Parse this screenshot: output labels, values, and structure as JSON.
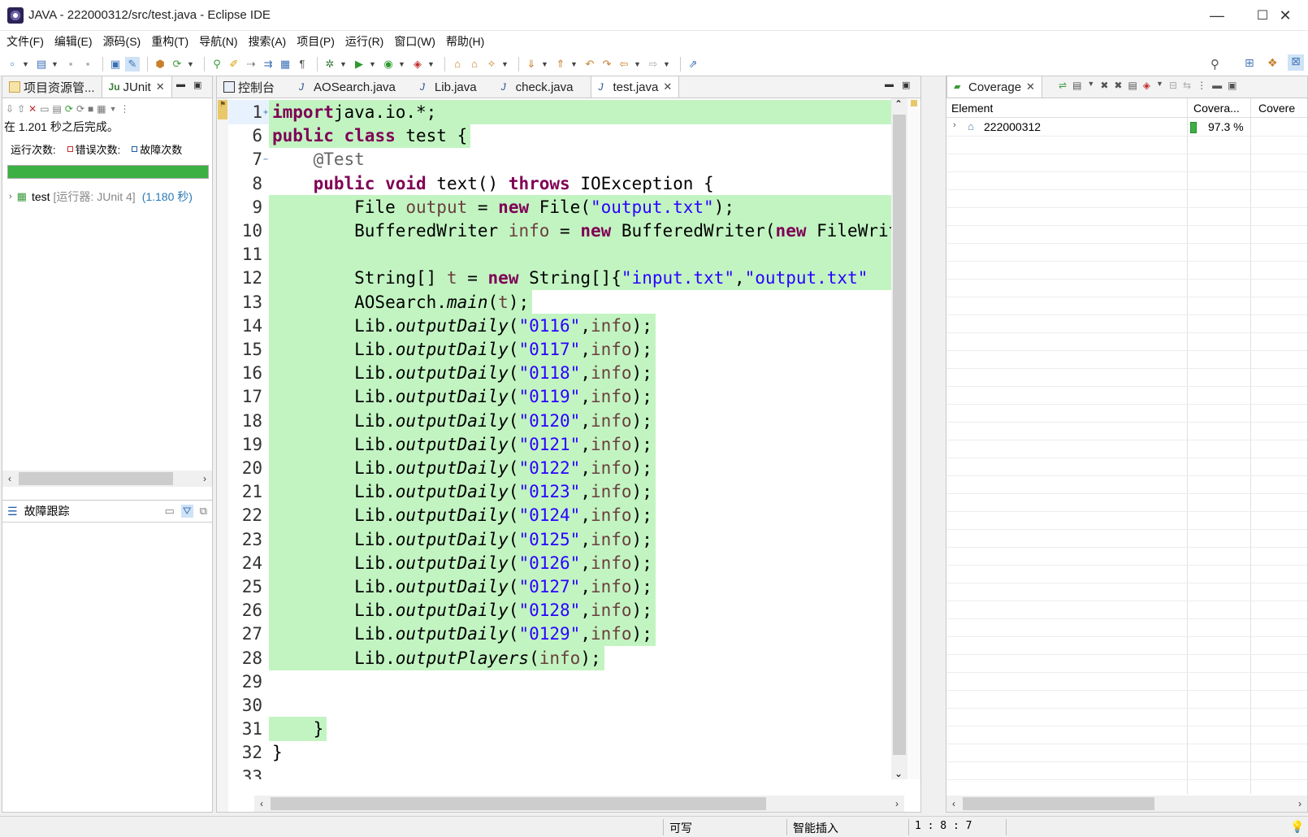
{
  "window": {
    "title": "JAVA - 222000312/src/test.java - Eclipse IDE",
    "minimize": "—",
    "maximize": "☐",
    "close": "✕"
  },
  "menu": [
    "文件(F)",
    "编辑(E)",
    "源码(S)",
    "重构(T)",
    "导航(N)",
    "搜索(A)",
    "项目(P)",
    "运行(R)",
    "窗口(W)",
    "帮助(H)"
  ],
  "left_panel": {
    "tabs": [
      {
        "label": "项目资源管...",
        "icon": "package-explorer-icon"
      },
      {
        "label": "JUnit",
        "icon": "junit-icon",
        "close": "✕"
      }
    ],
    "status": "在 1.201 秒之后完成。",
    "runs_label": "运行次数:",
    "errors_label": "错误次数:",
    "failures_label": "故障次数",
    "progress": 1.0,
    "progress_color": "#3cb043",
    "tree": {
      "name": "test",
      "runner": "[运行器: JUnit 4]",
      "time": "(1.180 秒)"
    }
  },
  "trace_panel": {
    "title": "故障跟踪"
  },
  "editor": {
    "tabs": [
      {
        "label": "控制台",
        "icon": "console-icon",
        "active": false
      },
      {
        "label": "AOSearch.java",
        "icon": "java-file-icon",
        "active": false
      },
      {
        "label": "Lib.java",
        "icon": "java-file-icon",
        "active": false
      },
      {
        "label": "check.java",
        "icon": "java-file-icon",
        "active": false
      },
      {
        "label": "test.java",
        "icon": "java-file-icon",
        "active": true,
        "close": "✕"
      }
    ],
    "lines": [
      {
        "n": "1",
        "fold": "+",
        "hl": "full",
        "tokens": [
          [
            "kw",
            "import"
          ],
          [
            "",
            "java.io.*;"
          ]
        ]
      },
      {
        "n": "6",
        "fold": "",
        "hl": "part",
        "tokens": [
          [
            "kw",
            "public"
          ],
          [
            "",
            " "
          ],
          [
            "kw",
            "class"
          ],
          [
            "",
            " test {"
          ]
        ]
      },
      {
        "n": "7",
        "fold": "−",
        "hl": "none",
        "tokens": [
          [
            "",
            "    "
          ],
          [
            "ann",
            "@Test"
          ]
        ]
      },
      {
        "n": "8",
        "fold": "",
        "hl": "none",
        "tokens": [
          [
            "",
            "    "
          ],
          [
            "kw",
            "public"
          ],
          [
            "",
            " "
          ],
          [
            "kw",
            "void"
          ],
          [
            "",
            " text() "
          ],
          [
            "kw",
            "throws"
          ],
          [
            "",
            " IOException {"
          ]
        ]
      },
      {
        "n": "9",
        "fold": "",
        "hl": "full",
        "tokens": [
          [
            "",
            "        File "
          ],
          [
            "var",
            "output"
          ],
          [
            "",
            " = "
          ],
          [
            "kw",
            "new"
          ],
          [
            "",
            " File("
          ],
          [
            "str",
            "\"output.txt\""
          ],
          [
            "",
            ");"
          ]
        ]
      },
      {
        "n": "10",
        "fold": "",
        "hl": "full",
        "tokens": [
          [
            "",
            "        BufferedWriter "
          ],
          [
            "var",
            "info"
          ],
          [
            "",
            " = "
          ],
          [
            "kw",
            "new"
          ],
          [
            "",
            " BufferedWriter("
          ],
          [
            "kw",
            "new"
          ],
          [
            "",
            " FileWriter("
          ]
        ]
      },
      {
        "n": "11",
        "fold": "",
        "hl": "full",
        "tokens": [
          [
            "",
            ""
          ]
        ]
      },
      {
        "n": "12",
        "fold": "",
        "hl": "full",
        "tokens": [
          [
            "",
            "        String[] "
          ],
          [
            "var",
            "t"
          ],
          [
            "",
            " = "
          ],
          [
            "kw",
            "new"
          ],
          [
            "",
            " String[]{"
          ],
          [
            "str",
            "\"input.txt\""
          ],
          [
            "",
            ","
          ],
          [
            "str",
            "\"output.txt\""
          ]
        ]
      },
      {
        "n": "13",
        "fold": "",
        "hl": "part",
        "tokens": [
          [
            "",
            "        AOSearch."
          ],
          [
            "ital",
            "main"
          ],
          [
            "",
            "("
          ],
          [
            "var",
            "t"
          ],
          [
            "",
            ");"
          ]
        ]
      },
      {
        "n": "14",
        "fold": "",
        "hl": "part",
        "tokens": [
          [
            "",
            "        Lib."
          ],
          [
            "ital",
            "outputDaily"
          ],
          [
            "",
            "("
          ],
          [
            "str",
            "\"0116\""
          ],
          [
            "",
            ","
          ],
          [
            "var",
            "info"
          ],
          [
            "",
            ");"
          ]
        ]
      },
      {
        "n": "15",
        "fold": "",
        "hl": "part",
        "tokens": [
          [
            "",
            "        Lib."
          ],
          [
            "ital",
            "outputDaily"
          ],
          [
            "",
            "("
          ],
          [
            "str",
            "\"0117\""
          ],
          [
            "",
            ","
          ],
          [
            "var",
            "info"
          ],
          [
            "",
            ");"
          ]
        ]
      },
      {
        "n": "16",
        "fold": "",
        "hl": "part",
        "tokens": [
          [
            "",
            "        Lib."
          ],
          [
            "ital",
            "outputDaily"
          ],
          [
            "",
            "("
          ],
          [
            "str",
            "\"0118\""
          ],
          [
            "",
            ","
          ],
          [
            "var",
            "info"
          ],
          [
            "",
            ");"
          ]
        ]
      },
      {
        "n": "17",
        "fold": "",
        "hl": "part",
        "tokens": [
          [
            "",
            "        Lib."
          ],
          [
            "ital",
            "outputDaily"
          ],
          [
            "",
            "("
          ],
          [
            "str",
            "\"0119\""
          ],
          [
            "",
            ","
          ],
          [
            "var",
            "info"
          ],
          [
            "",
            ");"
          ]
        ]
      },
      {
        "n": "18",
        "fold": "",
        "hl": "part",
        "tokens": [
          [
            "",
            "        Lib."
          ],
          [
            "ital",
            "outputDaily"
          ],
          [
            "",
            "("
          ],
          [
            "str",
            "\"0120\""
          ],
          [
            "",
            ","
          ],
          [
            "var",
            "info"
          ],
          [
            "",
            ");"
          ]
        ]
      },
      {
        "n": "19",
        "fold": "",
        "hl": "part",
        "tokens": [
          [
            "",
            "        Lib."
          ],
          [
            "ital",
            "outputDaily"
          ],
          [
            "",
            "("
          ],
          [
            "str",
            "\"0121\""
          ],
          [
            "",
            ","
          ],
          [
            "var",
            "info"
          ],
          [
            "",
            ");"
          ]
        ]
      },
      {
        "n": "20",
        "fold": "",
        "hl": "part",
        "tokens": [
          [
            "",
            "        Lib."
          ],
          [
            "ital",
            "outputDaily"
          ],
          [
            "",
            "("
          ],
          [
            "str",
            "\"0122\""
          ],
          [
            "",
            ","
          ],
          [
            "var",
            "info"
          ],
          [
            "",
            ");"
          ]
        ]
      },
      {
        "n": "21",
        "fold": "",
        "hl": "part",
        "tokens": [
          [
            "",
            "        Lib."
          ],
          [
            "ital",
            "outputDaily"
          ],
          [
            "",
            "("
          ],
          [
            "str",
            "\"0123\""
          ],
          [
            "",
            ","
          ],
          [
            "var",
            "info"
          ],
          [
            "",
            ");"
          ]
        ]
      },
      {
        "n": "22",
        "fold": "",
        "hl": "part",
        "tokens": [
          [
            "",
            "        Lib."
          ],
          [
            "ital",
            "outputDaily"
          ],
          [
            "",
            "("
          ],
          [
            "str",
            "\"0124\""
          ],
          [
            "",
            ","
          ],
          [
            "var",
            "info"
          ],
          [
            "",
            ");"
          ]
        ]
      },
      {
        "n": "23",
        "fold": "",
        "hl": "part",
        "tokens": [
          [
            "",
            "        Lib."
          ],
          [
            "ital",
            "outputDaily"
          ],
          [
            "",
            "("
          ],
          [
            "str",
            "\"0125\""
          ],
          [
            "",
            ","
          ],
          [
            "var",
            "info"
          ],
          [
            "",
            ");"
          ]
        ]
      },
      {
        "n": "24",
        "fold": "",
        "hl": "part",
        "tokens": [
          [
            "",
            "        Lib."
          ],
          [
            "ital",
            "outputDaily"
          ],
          [
            "",
            "("
          ],
          [
            "str",
            "\"0126\""
          ],
          [
            "",
            ","
          ],
          [
            "var",
            "info"
          ],
          [
            "",
            ");"
          ]
        ]
      },
      {
        "n": "25",
        "fold": "",
        "hl": "part",
        "tokens": [
          [
            "",
            "        Lib."
          ],
          [
            "ital",
            "outputDaily"
          ],
          [
            "",
            "("
          ],
          [
            "str",
            "\"0127\""
          ],
          [
            "",
            ","
          ],
          [
            "var",
            "info"
          ],
          [
            "",
            ");"
          ]
        ]
      },
      {
        "n": "26",
        "fold": "",
        "hl": "part",
        "tokens": [
          [
            "",
            "        Lib."
          ],
          [
            "ital",
            "outputDaily"
          ],
          [
            "",
            "("
          ],
          [
            "str",
            "\"0128\""
          ],
          [
            "",
            ","
          ],
          [
            "var",
            "info"
          ],
          [
            "",
            ");"
          ]
        ]
      },
      {
        "n": "27",
        "fold": "",
        "hl": "part",
        "tokens": [
          [
            "",
            "        Lib."
          ],
          [
            "ital",
            "outputDaily"
          ],
          [
            "",
            "("
          ],
          [
            "str",
            "\"0129\""
          ],
          [
            "",
            ","
          ],
          [
            "var",
            "info"
          ],
          [
            "",
            ");"
          ]
        ]
      },
      {
        "n": "28",
        "fold": "",
        "hl": "part",
        "tokens": [
          [
            "",
            "        Lib."
          ],
          [
            "ital",
            "outputPlayers"
          ],
          [
            "",
            "("
          ],
          [
            "var",
            "info"
          ],
          [
            "",
            ");"
          ]
        ]
      },
      {
        "n": "29",
        "fold": "",
        "hl": "none",
        "tokens": [
          [
            "",
            ""
          ]
        ]
      },
      {
        "n": "30",
        "fold": "",
        "hl": "none",
        "tokens": [
          [
            "",
            ""
          ]
        ]
      },
      {
        "n": "31",
        "fold": "",
        "hl": "part",
        "tokens": [
          [
            "",
            "    }"
          ]
        ]
      },
      {
        "n": "32",
        "fold": "",
        "hl": "none",
        "tokens": [
          [
            "",
            "}"
          ]
        ]
      },
      {
        "n": "33",
        "fold": "",
        "hl": "none",
        "tokens": [
          [
            "",
            ""
          ]
        ]
      }
    ]
  },
  "coverage": {
    "tab_label": "Coverage",
    "close": "✕",
    "columns": [
      "Element",
      "Covera...",
      "Covere"
    ],
    "rows": [
      {
        "element": "222000312",
        "coverage": "97.3 %",
        "ratio": 0.973
      }
    ]
  },
  "status": {
    "writable": "可写",
    "insert_mode": "智能插入",
    "position": "1 : 8 : 7"
  }
}
